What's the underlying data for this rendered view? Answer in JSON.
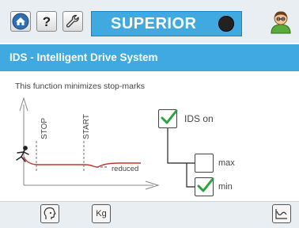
{
  "toolbar": {
    "brand": "SUPERIOR",
    "icons": [
      "home-icon",
      "help-icon",
      "wrench-icon",
      "knob-icon",
      "user-icon"
    ]
  },
  "header": {
    "title": "IDS - Intelligent Drive System"
  },
  "main": {
    "description": "This function minimizes stop-marks",
    "diagram": {
      "stop_label": "STOP",
      "start_label": "START",
      "reduced_label": "reduced"
    },
    "options": {
      "ids_on": {
        "label": "IDS on",
        "checked": true
      },
      "max": {
        "label": "max",
        "checked": false
      },
      "min": {
        "label": "min",
        "checked": true
      }
    }
  },
  "footer": {
    "weight_label": "Kg",
    "icons": [
      "head-profile-icon",
      "weight-icon",
      "curve-chart-icon"
    ]
  },
  "colors": {
    "accent": "#3fa9e0",
    "check": "#2aa33c",
    "curve": "#c0392b",
    "bar_bg": "#e8eef2"
  }
}
